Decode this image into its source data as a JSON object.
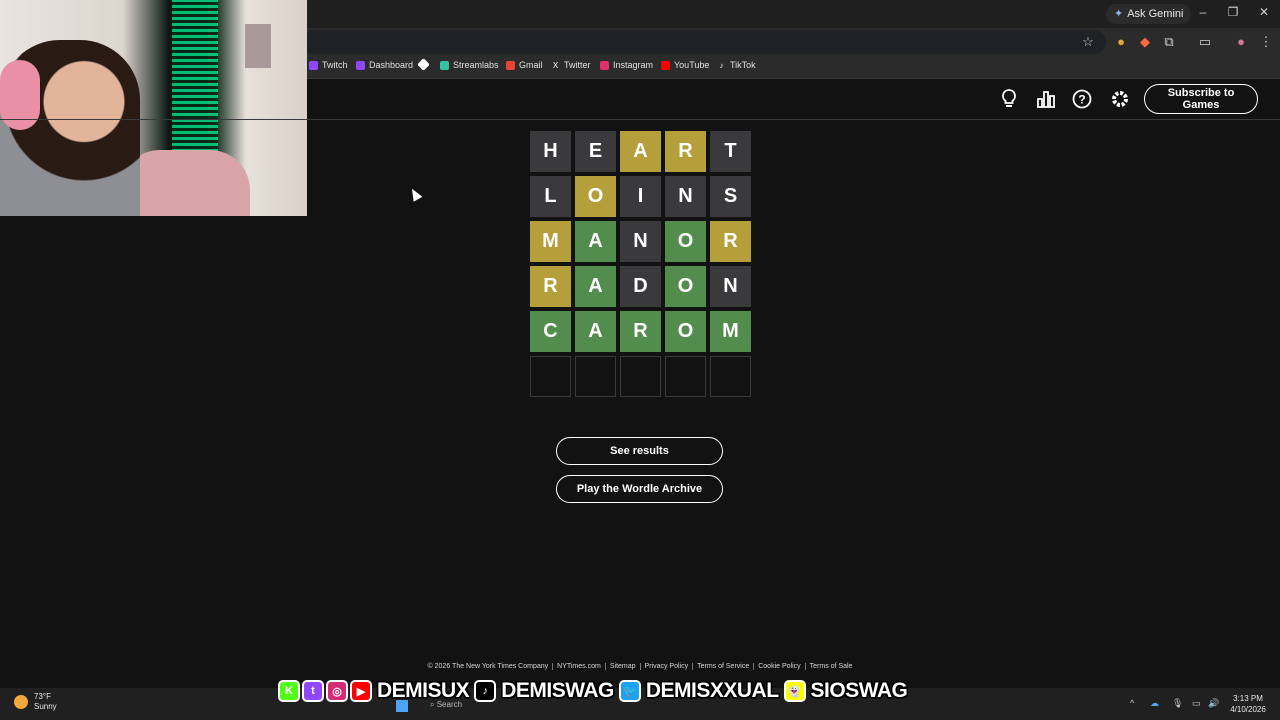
{
  "browser": {
    "ask_gemini": "Ask Gemini",
    "window_controls": [
      "–",
      "❐",
      "✕"
    ],
    "bookmarks": [
      {
        "label": "Twitch",
        "color": "#9146ff"
      },
      {
        "label": "Dashboard",
        "color": "#9146ff"
      },
      {
        "label": "",
        "color": "#ffffff"
      },
      {
        "label": "Streamlabs",
        "color": "#31c3a2"
      },
      {
        "label": "Gmail",
        "color": "#ea4335"
      },
      {
        "label": "Twitter",
        "color": "#ffffff"
      },
      {
        "label": "Instagram",
        "color": "#e1306c"
      },
      {
        "label": "YouTube",
        "color": "#ff0000"
      },
      {
        "label": "TikTok",
        "color": "#ffffff"
      }
    ]
  },
  "header": {
    "subscribe_label": "Subscribe to Games",
    "icons": [
      "hint-icon",
      "stats-icon",
      "help-icon",
      "settings-icon"
    ]
  },
  "board": {
    "rows": [
      [
        {
          "l": "H",
          "s": "absent"
        },
        {
          "l": "E",
          "s": "absent"
        },
        {
          "l": "A",
          "s": "present"
        },
        {
          "l": "R",
          "s": "present"
        },
        {
          "l": "T",
          "s": "absent"
        }
      ],
      [
        {
          "l": "L",
          "s": "absent"
        },
        {
          "l": "O",
          "s": "present"
        },
        {
          "l": "I",
          "s": "absent"
        },
        {
          "l": "N",
          "s": "absent"
        },
        {
          "l": "S",
          "s": "absent"
        }
      ],
      [
        {
          "l": "M",
          "s": "present"
        },
        {
          "l": "A",
          "s": "correct"
        },
        {
          "l": "N",
          "s": "absent"
        },
        {
          "l": "O",
          "s": "correct"
        },
        {
          "l": "R",
          "s": "present"
        }
      ],
      [
        {
          "l": "R",
          "s": "present"
        },
        {
          "l": "A",
          "s": "correct"
        },
        {
          "l": "D",
          "s": "absent"
        },
        {
          "l": "O",
          "s": "correct"
        },
        {
          "l": "N",
          "s": "absent"
        }
      ],
      [
        {
          "l": "C",
          "s": "correct"
        },
        {
          "l": "A",
          "s": "correct"
        },
        {
          "l": "R",
          "s": "correct"
        },
        {
          "l": "O",
          "s": "correct"
        },
        {
          "l": "M",
          "s": "correct"
        }
      ],
      [
        {
          "l": "",
          "s": "empty"
        },
        {
          "l": "",
          "s": "empty"
        },
        {
          "l": "",
          "s": "empty"
        },
        {
          "l": "",
          "s": "empty"
        },
        {
          "l": "",
          "s": "empty"
        }
      ]
    ]
  },
  "actions": {
    "see_results": "See results",
    "archive": "Play the Wordle Archive"
  },
  "footer": [
    "© 2026 The New York Times Company",
    "NYTimes.com",
    "Sitemap",
    "Privacy Policy",
    "Terms of Service",
    "Cookie Policy",
    "Terms of Sale"
  ],
  "banner": {
    "items": [
      {
        "icon": "K",
        "color": "#53fc18",
        "handle": ""
      },
      {
        "icon": "t",
        "color": "#9146ff",
        "handle": ""
      },
      {
        "icon": "◎",
        "color": "#d62976",
        "handle": ""
      },
      {
        "icon": "▶",
        "color": "#ff0000",
        "handle": "DEMISUX"
      },
      {
        "icon": "♪",
        "color": "#000000",
        "handle": "DEMISWAG"
      },
      {
        "icon": "🐦",
        "color": "#1da1f2",
        "handle": "DEMISXXUAL"
      },
      {
        "icon": "👻",
        "color": "#fffc00",
        "handle": "SIOSWAG"
      }
    ]
  },
  "taskbar": {
    "temp": "73°F",
    "condition": "Sunny",
    "search": "Search",
    "time": "3:13 PM",
    "date": "4/10/2026"
  }
}
